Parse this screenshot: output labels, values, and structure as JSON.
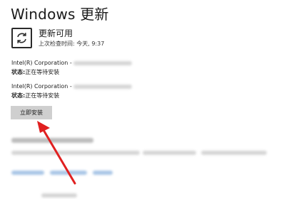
{
  "header": {
    "title": "Windows 更新"
  },
  "status": {
    "icon": "sync-icon",
    "title": "更新可用",
    "last_checked": "上次检查时间: 今天, 9:37"
  },
  "updates": [
    {
      "name": "Intel(R) Corporation -",
      "status_label": "状态:",
      "status_value": "正在等待安装"
    },
    {
      "name": "Intel(R) Corporation -",
      "status_label": "状态:",
      "status_value": "正在等待安装"
    }
  ],
  "actions": {
    "install_label": "立即安装"
  },
  "colors": {
    "button_bg": "#cfcfcf",
    "arrow": "#e02020",
    "link_blur": "#a9c6e6"
  }
}
